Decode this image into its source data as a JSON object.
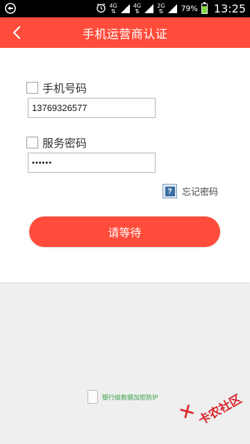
{
  "status_bar": {
    "network_1": "4G",
    "network_2": "4G",
    "network_3": "2G",
    "battery": "79%",
    "battery_level": 0.79,
    "time": "13:25"
  },
  "header": {
    "title": "手机运营商认证"
  },
  "form": {
    "phone_label": "手机号码",
    "phone_value": "13769326577",
    "password_label": "服务密码",
    "password_value": "••••••",
    "forgot_label": "忘记密码",
    "help_glyph": "?",
    "submit_label": "请等待"
  },
  "footer": {
    "security_text": "银行级数据加密防护"
  },
  "watermark": {
    "text": "卡农社区"
  },
  "colors": {
    "brand": "#ff4c3b",
    "page_bg": "#efefef",
    "secure_text": "#3aa14a"
  }
}
